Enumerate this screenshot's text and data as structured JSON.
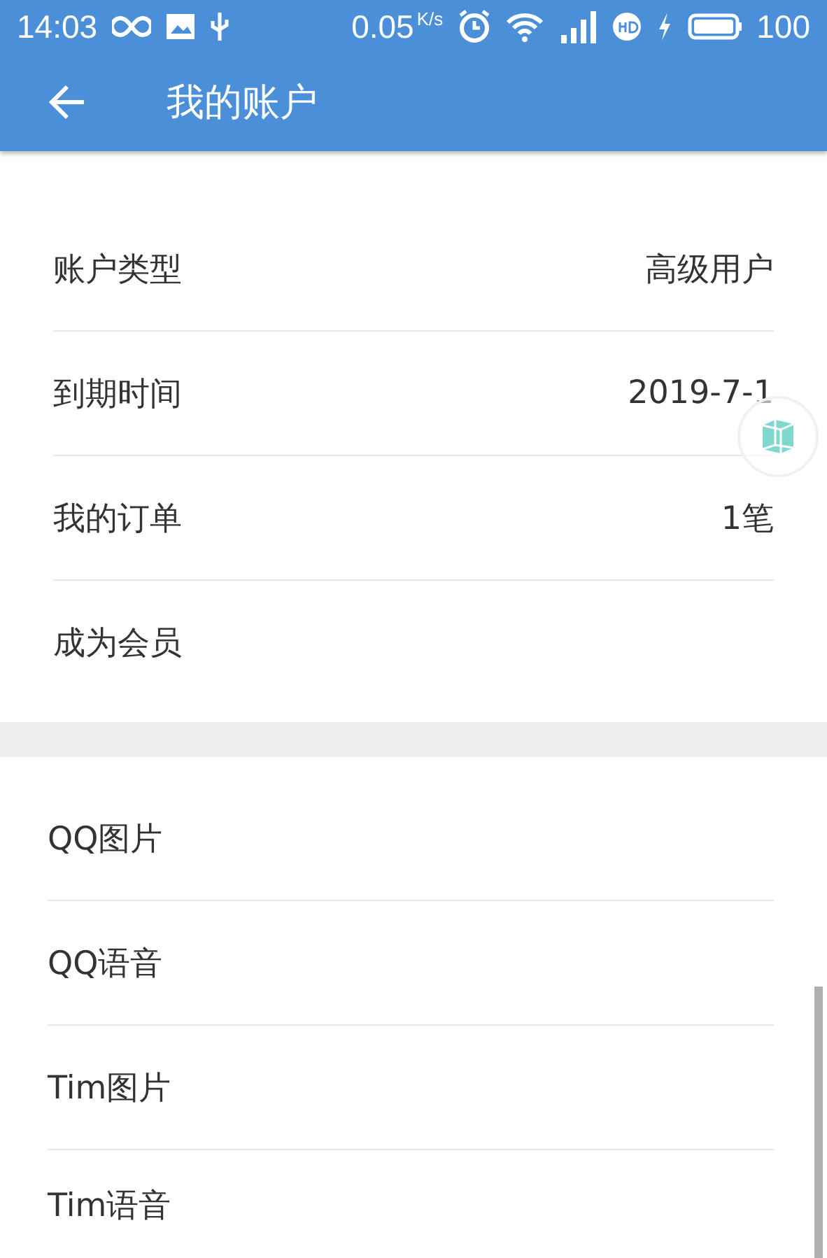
{
  "status_bar": {
    "time": "14:03",
    "speed": "0.05",
    "speed_unit": "K/s",
    "battery": "100"
  },
  "toolbar": {
    "title": "我的账户"
  },
  "sections": [
    {
      "rows": [
        {
          "label": "账户类型",
          "value": "高级用户"
        },
        {
          "label": "到期时间",
          "value": "2019-7-1"
        },
        {
          "label": "我的订单",
          "value": "1笔"
        },
        {
          "label": "成为会员"
        }
      ]
    },
    {
      "rows": [
        {
          "label": "QQ图片"
        },
        {
          "label": "QQ语音"
        },
        {
          "label": "Tim图片"
        },
        {
          "label": "Tim语音"
        }
      ]
    }
  ]
}
